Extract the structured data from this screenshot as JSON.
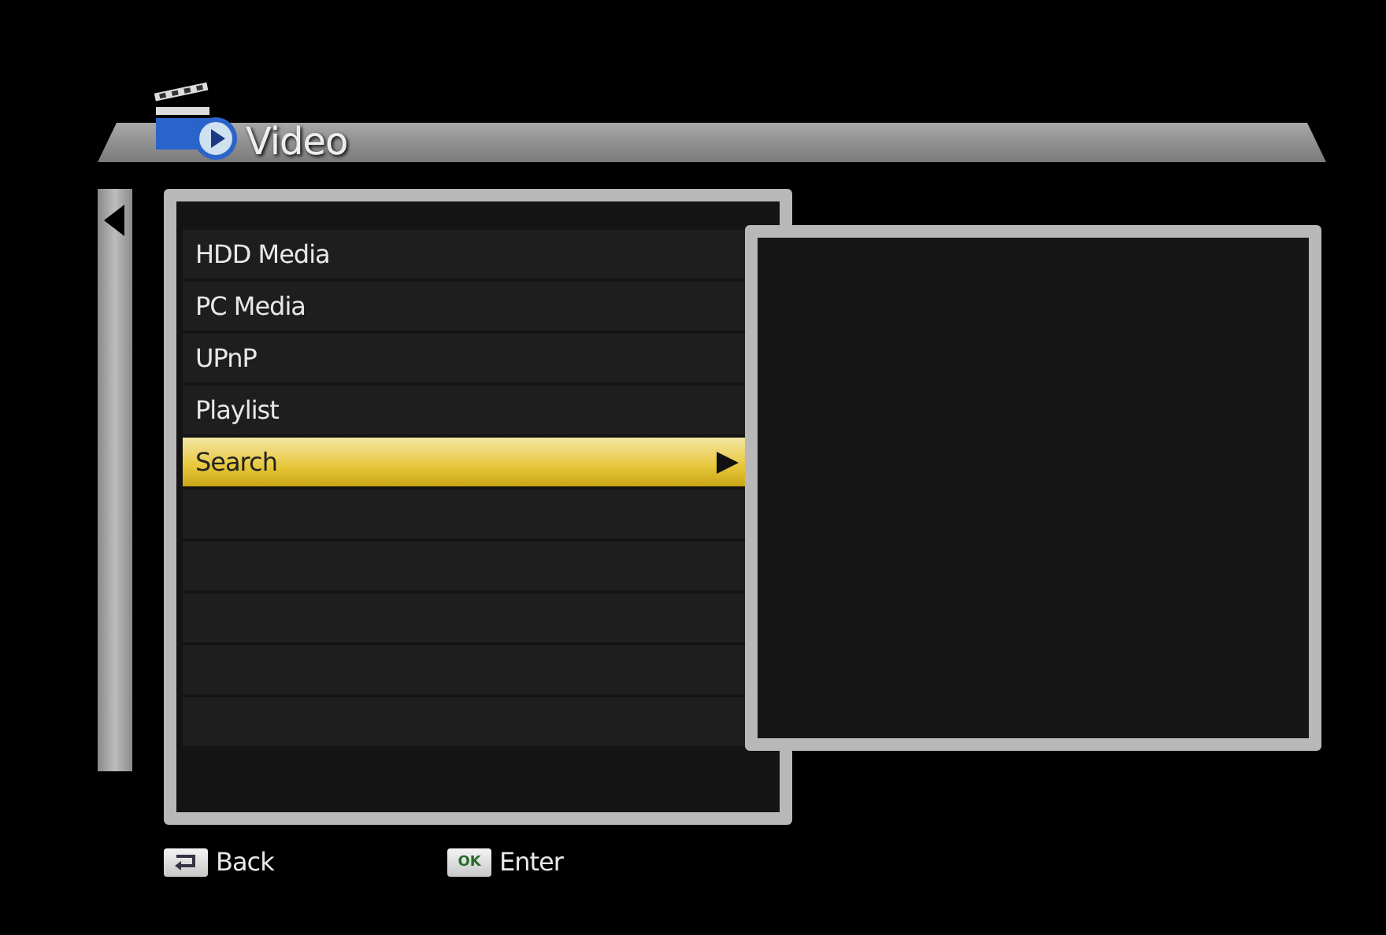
{
  "header": {
    "title": "Video"
  },
  "menu": [
    {
      "label": "HDD Media",
      "selected": false
    },
    {
      "label": "PC Media",
      "selected": false
    },
    {
      "label": "UPnP",
      "selected": false
    },
    {
      "label": "Playlist",
      "selected": false
    },
    {
      "label": "Search",
      "selected": true
    }
  ],
  "footer": [
    {
      "kind": "back",
      "label": "Back"
    },
    {
      "kind": "ok",
      "key": "OK",
      "label": "Enter"
    }
  ]
}
